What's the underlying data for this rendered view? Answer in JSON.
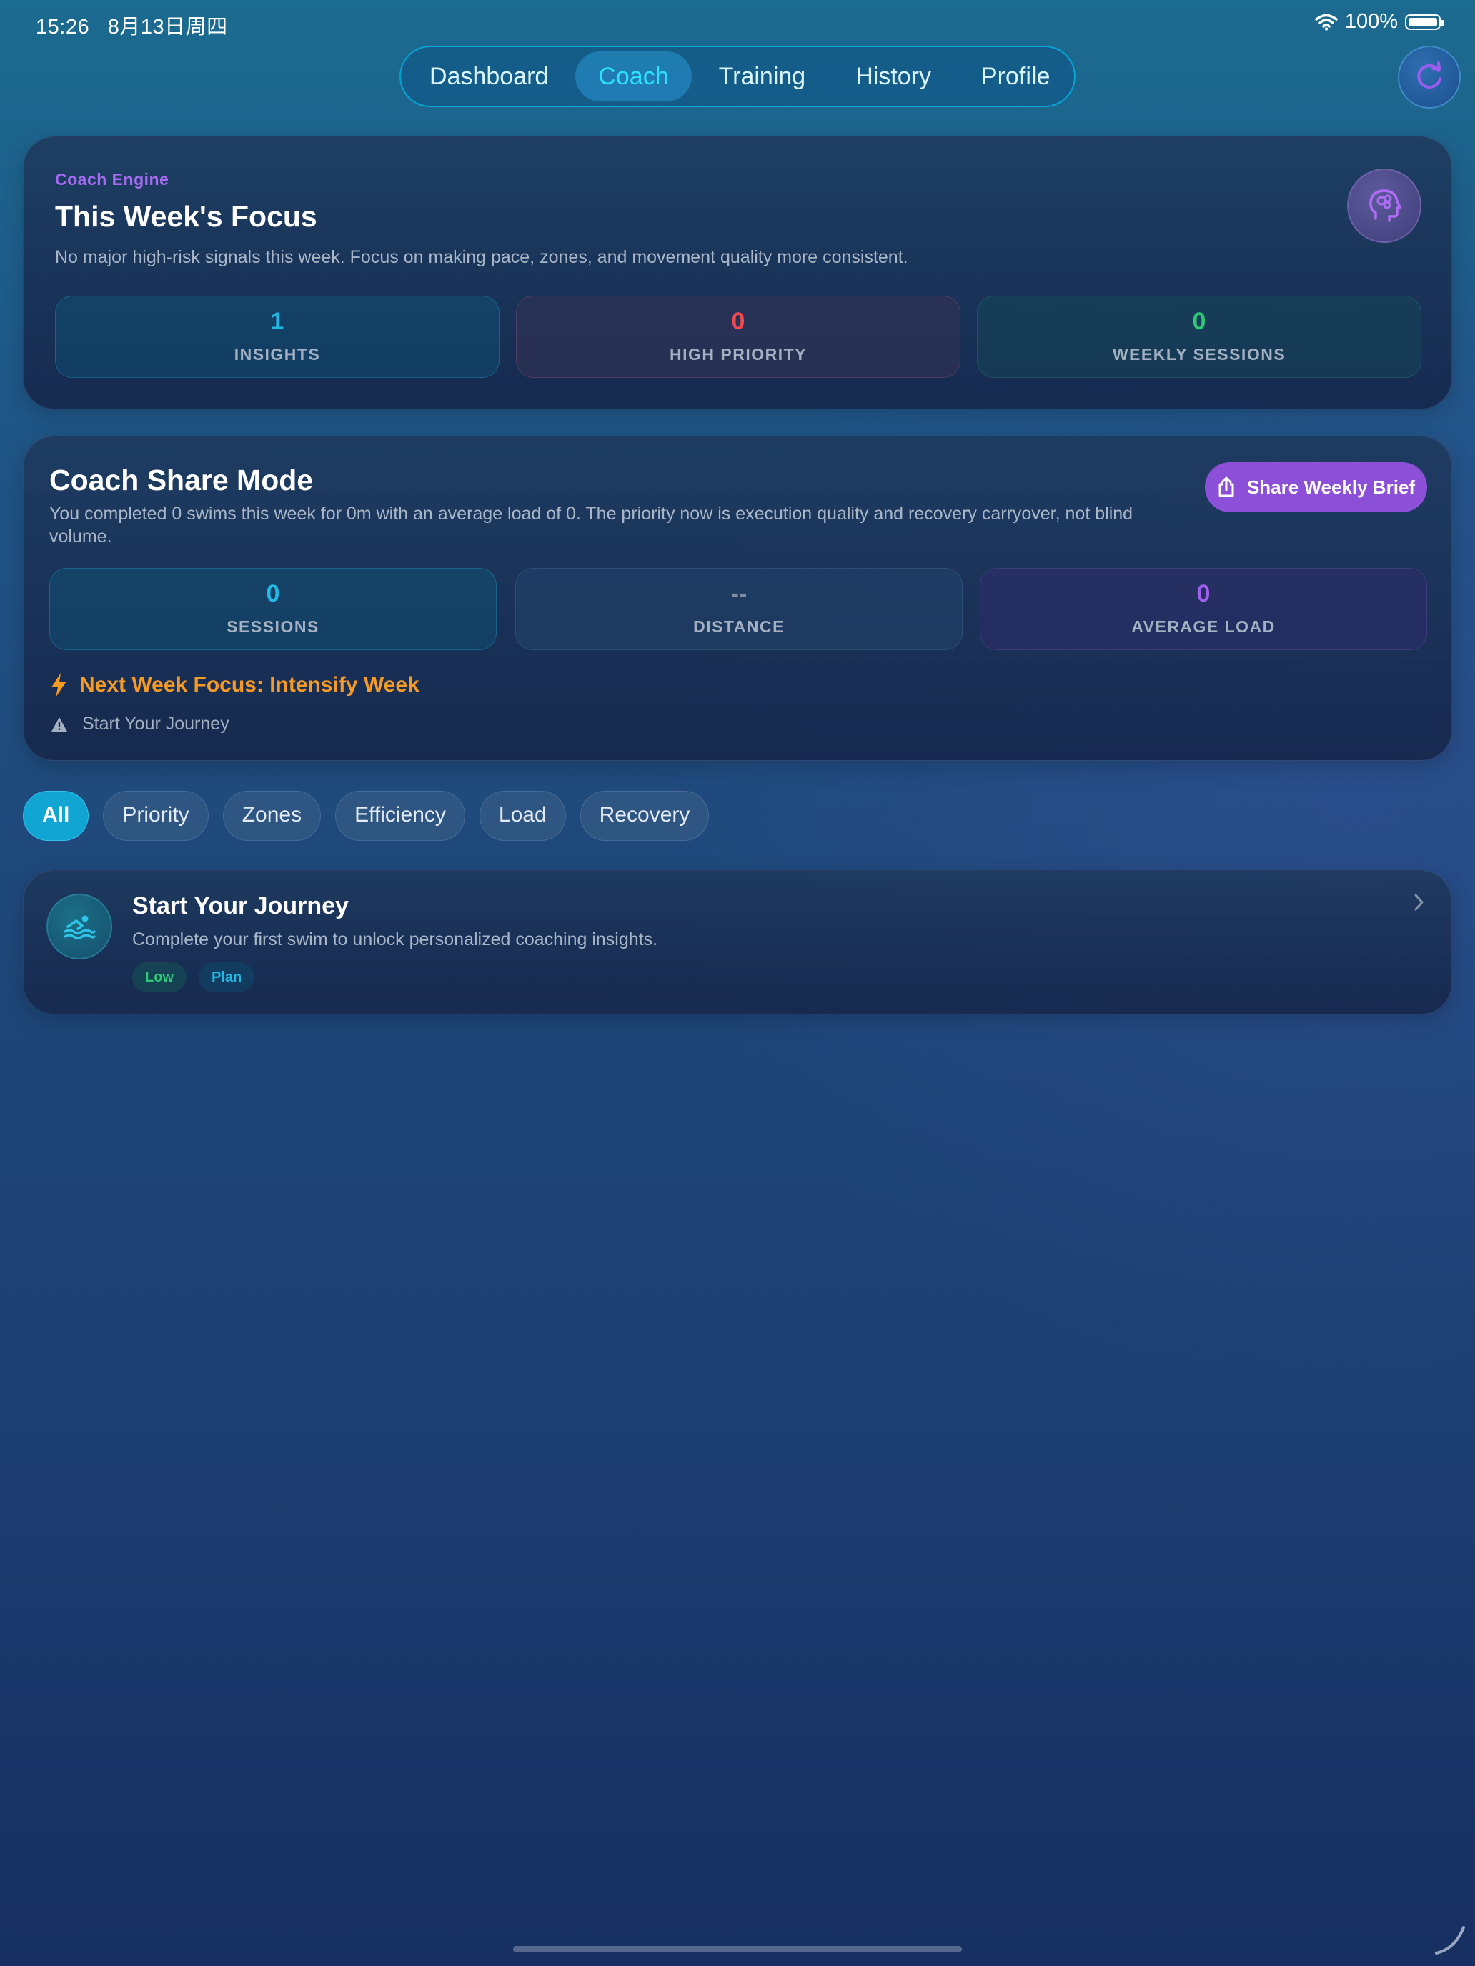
{
  "status_bar": {
    "time": "15:26",
    "date": "8月13日周四",
    "battery": "100%"
  },
  "tabs": [
    {
      "label": "Dashboard",
      "active": false
    },
    {
      "label": "Coach",
      "active": true
    },
    {
      "label": "Training",
      "active": false
    },
    {
      "label": "History",
      "active": false
    },
    {
      "label": "Profile",
      "active": false
    }
  ],
  "focus_card": {
    "eyebrow": "Coach Engine",
    "title": "This Week's Focus",
    "description": "No major high-risk signals this week. Focus on making pace, zones, and movement quality more consistent.",
    "stats": [
      {
        "value": "1",
        "label": "INSIGHTS"
      },
      {
        "value": "0",
        "label": "HIGH PRIORITY"
      },
      {
        "value": "0",
        "label": "WEEKLY SESSIONS"
      }
    ]
  },
  "share_card": {
    "title": "Coach Share Mode",
    "description": "You completed 0 swims this week for 0m with an average load of 0. The priority now is execution quality and recovery carryover, not blind volume.",
    "button_label": "Share Weekly Brief",
    "stats": [
      {
        "value": "0",
        "label": "SESSIONS"
      },
      {
        "value": "--",
        "label": "DISTANCE"
      },
      {
        "value": "0",
        "label": "AVERAGE LOAD"
      }
    ],
    "next_week": "Next Week Focus: Intensify Week",
    "note": "Start Your Journey"
  },
  "filters": [
    {
      "label": "All",
      "active": true
    },
    {
      "label": "Priority",
      "active": false
    },
    {
      "label": "Zones",
      "active": false
    },
    {
      "label": "Efficiency",
      "active": false
    },
    {
      "label": "Load",
      "active": false
    },
    {
      "label": "Recovery",
      "active": false
    }
  ],
  "insight": {
    "title": "Start Your Journey",
    "description": "Complete your first swim to unlock personalized coaching insights.",
    "tags": [
      "Low",
      "Plan"
    ]
  },
  "colors": {
    "accent_cyan": "#22b8e4",
    "accent_purple": "#8b4fd8",
    "priority_red": "#ef4a4f",
    "success_green": "#2fc778",
    "warning_orange": "#f59a25"
  },
  "icons": [
    "wifi-icon",
    "battery-icon",
    "refresh-icon",
    "brain-icon",
    "share-icon",
    "bolt-icon",
    "warning-icon",
    "swimmer-icon",
    "chevron-right-icon"
  ]
}
